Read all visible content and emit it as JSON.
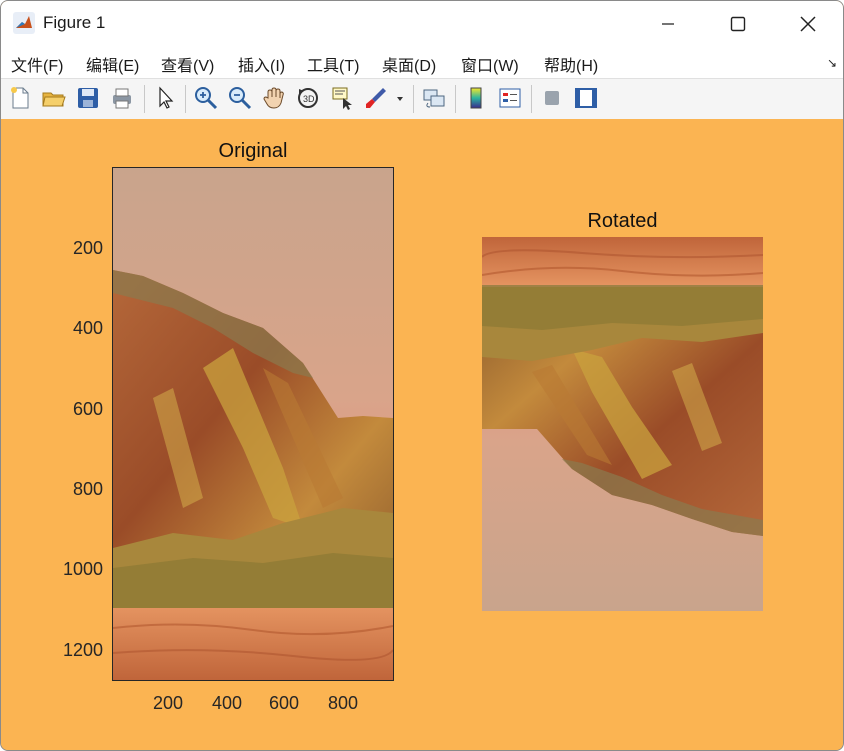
{
  "window": {
    "title": "Figure 1"
  },
  "menu": [
    {
      "label": "文件(F)"
    },
    {
      "label": "编辑(E)"
    },
    {
      "label": "查看(V)"
    },
    {
      "label": "插入(I)"
    },
    {
      "label": "工具(T)"
    },
    {
      "label": "桌面(D)"
    },
    {
      "label": "窗口(W)"
    },
    {
      "label": "帮助(H)"
    }
  ],
  "toolbar": [
    "new-figure-icon",
    "open-file-icon",
    "save-icon",
    "print-icon",
    "edit-plot-icon",
    "zoom-in-icon",
    "zoom-out-icon",
    "pan-icon",
    "rotate-3d-icon",
    "data-cursor-icon",
    "brush-icon",
    "link-plot-icon",
    "insert-colorbar-icon",
    "insert-legend-icon",
    "hide-plot-tools-icon",
    "show-plot-tools-icon"
  ],
  "figure": {
    "background": "#fbb452"
  },
  "subplot1": {
    "title": "Original",
    "xticks": [
      "200",
      "400",
      "600",
      "800"
    ],
    "yticks": [
      "200",
      "400",
      "600",
      "800",
      "1000",
      "1200"
    ]
  },
  "subplot2": {
    "title": "Rotated"
  }
}
